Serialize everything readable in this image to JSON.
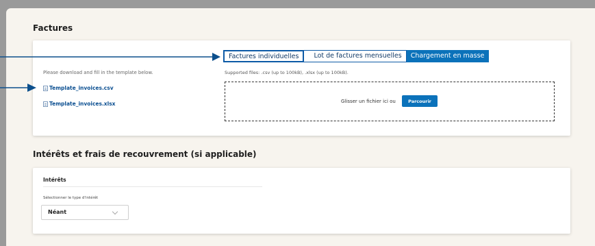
{
  "factures": {
    "title": "Factures",
    "tabs": [
      {
        "label": "Factures individuelles"
      },
      {
        "label": "Lot de factures mensuelles"
      },
      {
        "label": "Chargement en masse"
      }
    ],
    "instruction": "Please download and fill in the template below.",
    "templates": [
      {
        "label": "Template_invoices.csv"
      },
      {
        "label": "Template_invoices.xlsx"
      }
    ],
    "supported_files": "Supported files: .csv (up to 100kB), .xlsx (up to 100kB).",
    "drop_text": "Glisser un fichier ici  ou",
    "browse_label": "Parcourir"
  },
  "interets_section": {
    "title": "Intérêts et frais de recouvrement (si applicable)",
    "card_title": "Intérêts",
    "select_label": "Sélectionner le type d'intérêt",
    "select_value": "Néant"
  },
  "colors": {
    "accent": "#0b72ba",
    "annotation_arrow": "#0c4f8c"
  }
}
